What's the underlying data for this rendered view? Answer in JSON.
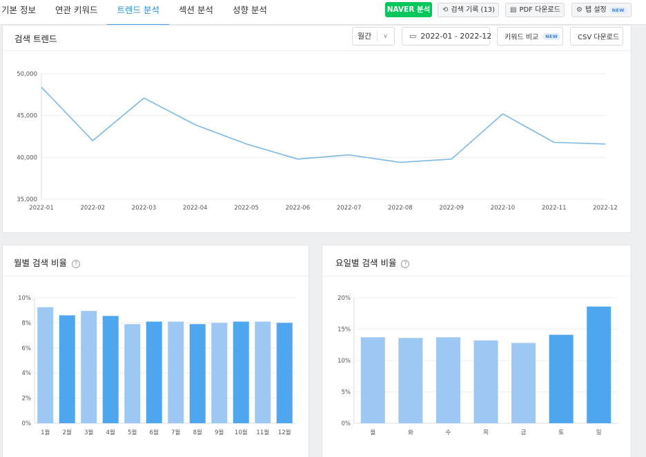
{
  "tabs": [
    {
      "label": "기본 정보",
      "active": false
    },
    {
      "label": "연관 키워드",
      "active": false
    },
    {
      "label": "트렌드 분석",
      "active": true
    },
    {
      "label": "섹션 분석",
      "active": false
    },
    {
      "label": "성향 분석",
      "active": false
    }
  ],
  "toolbar": {
    "naver_label": "NAVER 분석",
    "history_label": "검색 기록 (13)",
    "history_icon": "history-icon",
    "pdf_label": "PDF 다운로드",
    "pdf_icon": "file-icon",
    "settings_label": "탭 설정",
    "settings_icon": "gear-icon",
    "new_badge": "NEW"
  },
  "trend": {
    "title": "검색 트렌드",
    "period_select": "월간",
    "date_range": "2022-01 - 2022-12",
    "compare_label": "키워드 비교",
    "compare_badge": "NEW",
    "csv_label": "CSV 다운로드"
  },
  "monthly": {
    "title": "월별 검색 비율",
    "help_icon": "?"
  },
  "weekday": {
    "title": "요일별 검색 비율",
    "help_icon": "?"
  },
  "colors": {
    "line": "#7ab8e6",
    "bar_light": "#9ec8f4",
    "bar_dark": "#4da6ee",
    "accent": "#2d8fdd",
    "naver": "#03c75a"
  },
  "chart_data": [
    {
      "type": "line",
      "categories": [
        "2022-01",
        "2022-02",
        "2022-03",
        "2022-04",
        "2022-05",
        "2022-06",
        "2022-07",
        "2022-08",
        "2022-09",
        "2022-10",
        "2022-11",
        "2022-12"
      ],
      "series": [
        {
          "values": [
            48400,
            42000,
            47100,
            43900,
            41600,
            39800,
            40300,
            39400,
            39800,
            45200,
            41800,
            41600
          ]
        }
      ],
      "ylim": [
        35000,
        50000
      ],
      "yticks": [
        35000,
        40000,
        45000,
        50000
      ],
      "ytick_labels": [
        "35,000",
        "40,000",
        "45,000",
        "50,000"
      ],
      "grid": true
    },
    {
      "type": "bar",
      "categories": [
        "1월",
        "2월",
        "3월",
        "4월",
        "5월",
        "6월",
        "7월",
        "8월",
        "9월",
        "10월",
        "11월",
        "12월"
      ],
      "values": [
        9.25,
        8.6,
        8.95,
        8.55,
        7.9,
        8.1,
        8.1,
        7.9,
        8.0,
        8.1,
        8.1,
        8.0
      ],
      "highlight": [
        false,
        true,
        false,
        true,
        false,
        true,
        false,
        true,
        false,
        true,
        false,
        true
      ],
      "ylim": [
        0,
        10
      ],
      "yticks": [
        0,
        2,
        4,
        6,
        8,
        10
      ],
      "ytick_labels": [
        "0%",
        "2%",
        "4%",
        "6%",
        "8%",
        "10%"
      ],
      "grid": true
    },
    {
      "type": "bar",
      "categories": [
        "월",
        "화",
        "수",
        "목",
        "금",
        "토",
        "일"
      ],
      "values": [
        13.7,
        13.6,
        13.7,
        13.2,
        12.8,
        14.1,
        18.6
      ],
      "highlight": [
        false,
        false,
        false,
        false,
        false,
        true,
        true
      ],
      "ylim": [
        0,
        20
      ],
      "yticks": [
        0,
        5,
        10,
        15,
        20
      ],
      "ytick_labels": [
        "0%",
        "5%",
        "10%",
        "15%",
        "20%"
      ],
      "grid": true
    }
  ]
}
